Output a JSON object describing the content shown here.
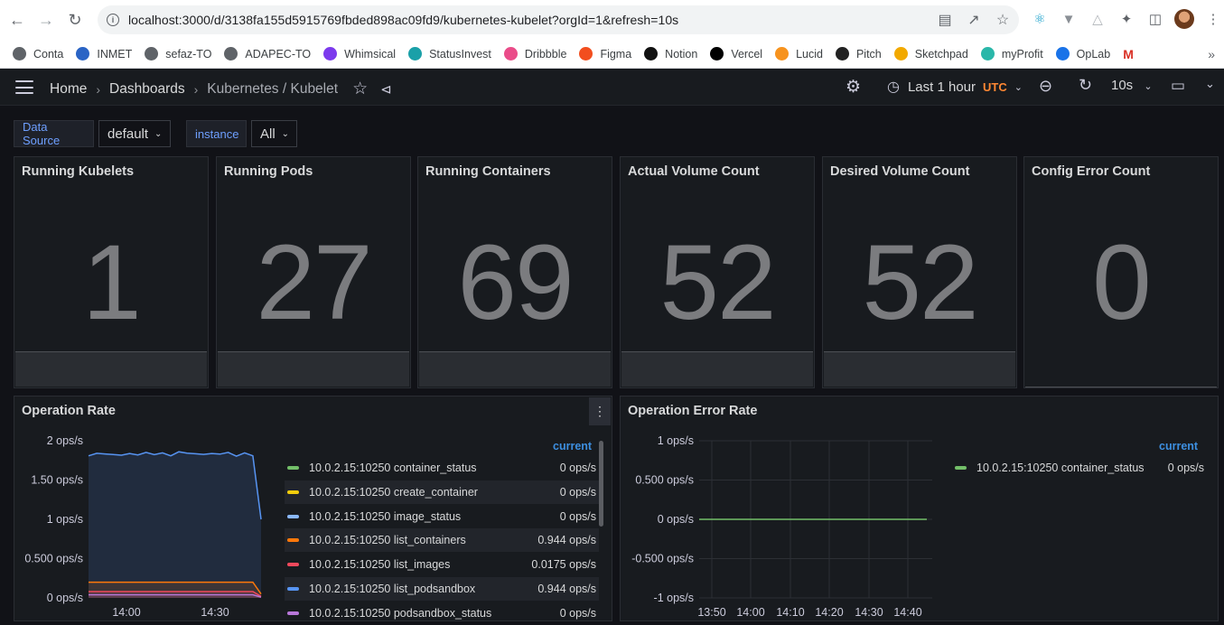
{
  "browser": {
    "url": "localhost:3000/d/3138fa155d5915769fbded898ac09fd9/kubernetes-kubelet?orgId=1&refresh=10s",
    "bookmarks": [
      {
        "label": "Conta",
        "color": "#5f6368"
      },
      {
        "label": "INMET",
        "color": "#2a64c5"
      },
      {
        "label": "sefaz-TO",
        "color": "#5f6368"
      },
      {
        "label": "ADAPEC-TO",
        "color": "#5f6368"
      },
      {
        "label": "Whimsical",
        "color": "#7c3aed"
      },
      {
        "label": "StatusInvest",
        "color": "#1aa0a8"
      },
      {
        "label": "Dribbble",
        "color": "#ea4c89"
      },
      {
        "label": "Figma",
        "color": "#f24e1e"
      },
      {
        "label": "Notion",
        "color": "#111111"
      },
      {
        "label": "Vercel",
        "color": "#000000"
      },
      {
        "label": "Lucid",
        "color": "#f7931e"
      },
      {
        "label": "Pitch",
        "color": "#222222"
      },
      {
        "label": "Sketchpad",
        "color": "#f2a900"
      },
      {
        "label": "myProfit",
        "color": "#2ab7a9"
      },
      {
        "label": "OpLab",
        "color": "#1a73e8"
      }
    ]
  },
  "header": {
    "breadcrumbs": [
      "Home",
      "Dashboards",
      "Kubernetes / Kubelet"
    ],
    "time_range": "Last 1 hour",
    "timezone": "UTC",
    "refresh": "10s"
  },
  "variables": [
    {
      "label": "Data Source",
      "value": "default"
    },
    {
      "label": "instance",
      "value": "All"
    }
  ],
  "stats": [
    {
      "title": "Running Kubelets",
      "value": "1"
    },
    {
      "title": "Running Pods",
      "value": "27"
    },
    {
      "title": "Running Containers",
      "value": "69"
    },
    {
      "title": "Actual Volume Count",
      "value": "52"
    },
    {
      "title": "Desired Volume Count",
      "value": "52"
    },
    {
      "title": "Config Error Count",
      "value": "0"
    }
  ],
  "operation_rate": {
    "title": "Operation Rate",
    "legend_header": "current",
    "legend": [
      {
        "name": "10.0.2.15:10250 container_status",
        "value": "0 ops/s",
        "color": "#73bf69"
      },
      {
        "name": "10.0.2.15:10250 create_container",
        "value": "0 ops/s",
        "color": "#f2cc0c"
      },
      {
        "name": "10.0.2.15:10250 image_status",
        "value": "0 ops/s",
        "color": "#8ab8ff"
      },
      {
        "name": "10.0.2.15:10250 list_containers",
        "value": "0.944 ops/s",
        "color": "#ff780a"
      },
      {
        "name": "10.0.2.15:10250 list_images",
        "value": "0.0175 ops/s",
        "color": "#f2495c"
      },
      {
        "name": "10.0.2.15:10250 list_podsandbox",
        "value": "0.944 ops/s",
        "color": "#5794f2"
      },
      {
        "name": "10.0.2.15:10250 podsandbox_status",
        "value": "0 ops/s",
        "color": "#b877d9"
      }
    ]
  },
  "operation_error_rate": {
    "title": "Operation Error Rate",
    "legend_header": "current",
    "legend": [
      {
        "name": "10.0.2.15:10250 container_status",
        "value": "0 ops/s",
        "color": "#73bf69"
      }
    ]
  },
  "chart_data": [
    {
      "type": "line",
      "title": "Operation Rate",
      "ylim": [
        0,
        2
      ],
      "y_ticks": [
        "2 ops/s",
        "1.50 ops/s",
        "1 ops/s",
        "0.500 ops/s",
        "0 ops/s"
      ],
      "x_ticks": [
        "14:00",
        "14:30"
      ],
      "series": [
        {
          "name": "10.0.2.15:10250 list_podsandbox",
          "values": [
            1.82,
            1.84,
            1.82,
            1.83,
            1.81,
            1.85,
            1.82,
            1.84,
            1.83,
            1.84,
            1.82,
            1.86,
            1.83,
            1.84,
            1.82,
            1.85,
            1.83,
            1.84,
            1.81,
            1.84,
            1.82,
            1.0
          ]
        },
        {
          "name": "10.0.2.15:10250 list_containers",
          "values": [
            0.2,
            0.2,
            0.2,
            0.2,
            0.2,
            0.2,
            0.2,
            0.2,
            0.2,
            0.2,
            0.2,
            0.2,
            0.2,
            0.2,
            0.2,
            0.2,
            0.2,
            0.2,
            0.2,
            0.2,
            0.2,
            0.05
          ]
        },
        {
          "name": "10.0.2.15:10250 list_images",
          "values": [
            0.08,
            0.08,
            0.08,
            0.08,
            0.08,
            0.08,
            0.08,
            0.08,
            0.08,
            0.08,
            0.08,
            0.08,
            0.08,
            0.08,
            0.08,
            0.08,
            0.08,
            0.08,
            0.08,
            0.08,
            0.08,
            0.02
          ]
        },
        {
          "name": "10.0.2.15:10250 podsandbox_status",
          "values": [
            0.04,
            0.04,
            0.04,
            0.04,
            0.04,
            0.04,
            0.04,
            0.04,
            0.04,
            0.04,
            0.04,
            0.04,
            0.04,
            0.04,
            0.04,
            0.04,
            0.04,
            0.04,
            0.04,
            0.04,
            0.04,
            0.01
          ]
        }
      ]
    },
    {
      "type": "line",
      "title": "Operation Error Rate",
      "ylim": [
        -1,
        1
      ],
      "y_ticks": [
        "1 ops/s",
        "0.500 ops/s",
        "0 ops/s",
        "-0.500 ops/s",
        "-1 ops/s"
      ],
      "x_ticks": [
        "13:50",
        "14:00",
        "14:10",
        "14:20",
        "14:30",
        "14:40"
      ],
      "series": [
        {
          "name": "10.0.2.15:10250 container_status",
          "values": [
            0,
            0
          ]
        }
      ]
    }
  ]
}
